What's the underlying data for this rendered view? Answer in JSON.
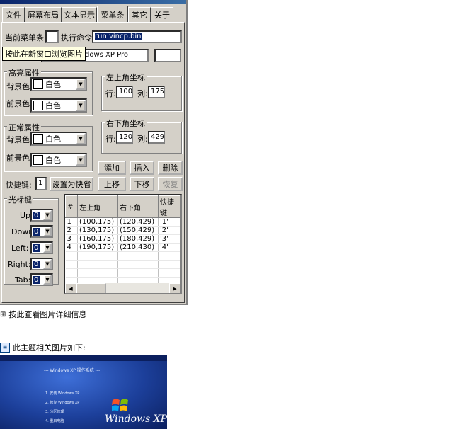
{
  "tabs": [
    "文件",
    "屏幕布局",
    "文本显示",
    "菜单条",
    "其它",
    "关于"
  ],
  "active_tab": 3,
  "row1": {
    "current_label": "当前菜单条",
    "current_value": "",
    "command_label": "执行命令:",
    "command_value": "run vincp.bin"
  },
  "row2": {
    "text_value": "dows XP Pro",
    "extra_value": ""
  },
  "tooltip": "按此在新窗口浏览图片",
  "highlight": {
    "title": "高亮属性",
    "bg_label": "背景色:",
    "bg_value": "白色",
    "fg_label": "前景色:",
    "fg_value": "白色"
  },
  "normal": {
    "title": "正常属性",
    "bg_label": "背景色:",
    "bg_value": "白色",
    "fg_label": "前景色:",
    "fg_value": "白色"
  },
  "top_left": {
    "title": "左上角坐标",
    "row_label": "行:",
    "row_value": "100",
    "col_label": "列:",
    "col_value": "175"
  },
  "bottom_right": {
    "title": "右下角坐标",
    "row_label": "行:",
    "row_value": "120",
    "col_label": "列:",
    "col_value": "429"
  },
  "buttons": {
    "add": "添加",
    "insert": "插入",
    "delete": "删除",
    "up": "上移",
    "down": "下移",
    "restore": "恢复",
    "set_shortcut": "设置为快省"
  },
  "shortcut": {
    "label": "快捷键:",
    "value": "1"
  },
  "cursor_keys": {
    "title": "光标键",
    "items": [
      {
        "label": "Up:",
        "value": "0"
      },
      {
        "label": "Down:",
        "value": "0"
      },
      {
        "label": "Left:",
        "value": "0"
      },
      {
        "label": "Right:",
        "value": "0"
      },
      {
        "label": "Tab:",
        "value": "0"
      }
    ]
  },
  "list": {
    "headers": [
      "#",
      "左上角",
      "右下角",
      "快捷键"
    ],
    "rows": [
      [
        "1",
        "(100,175)",
        "(120,429)",
        "'1'"
      ],
      [
        "2",
        "(130,175)",
        "(150,429)",
        "'2'"
      ],
      [
        "3",
        "(160,175)",
        "(180,429)",
        "'3'"
      ],
      [
        "4",
        "(190,175)",
        "(210,430)",
        "'4'"
      ]
    ]
  },
  "below": {
    "details_link": "按此查看图片详细信息",
    "related_label": "此主题相关图片如下:"
  },
  "xp_preview": {
    "heading": "--- Windows XP 操作系统 ---",
    "brand": "Windows XP",
    "menu": [
      "1. 安装 Windows XP",
      "2. 修复 Windows XP",
      "3. 分区管理",
      "4. 重启电脑"
    ]
  },
  "colors": {
    "face": "#d4d0c8",
    "selection": "#0a246a",
    "tooltip": "#ffffe1"
  }
}
